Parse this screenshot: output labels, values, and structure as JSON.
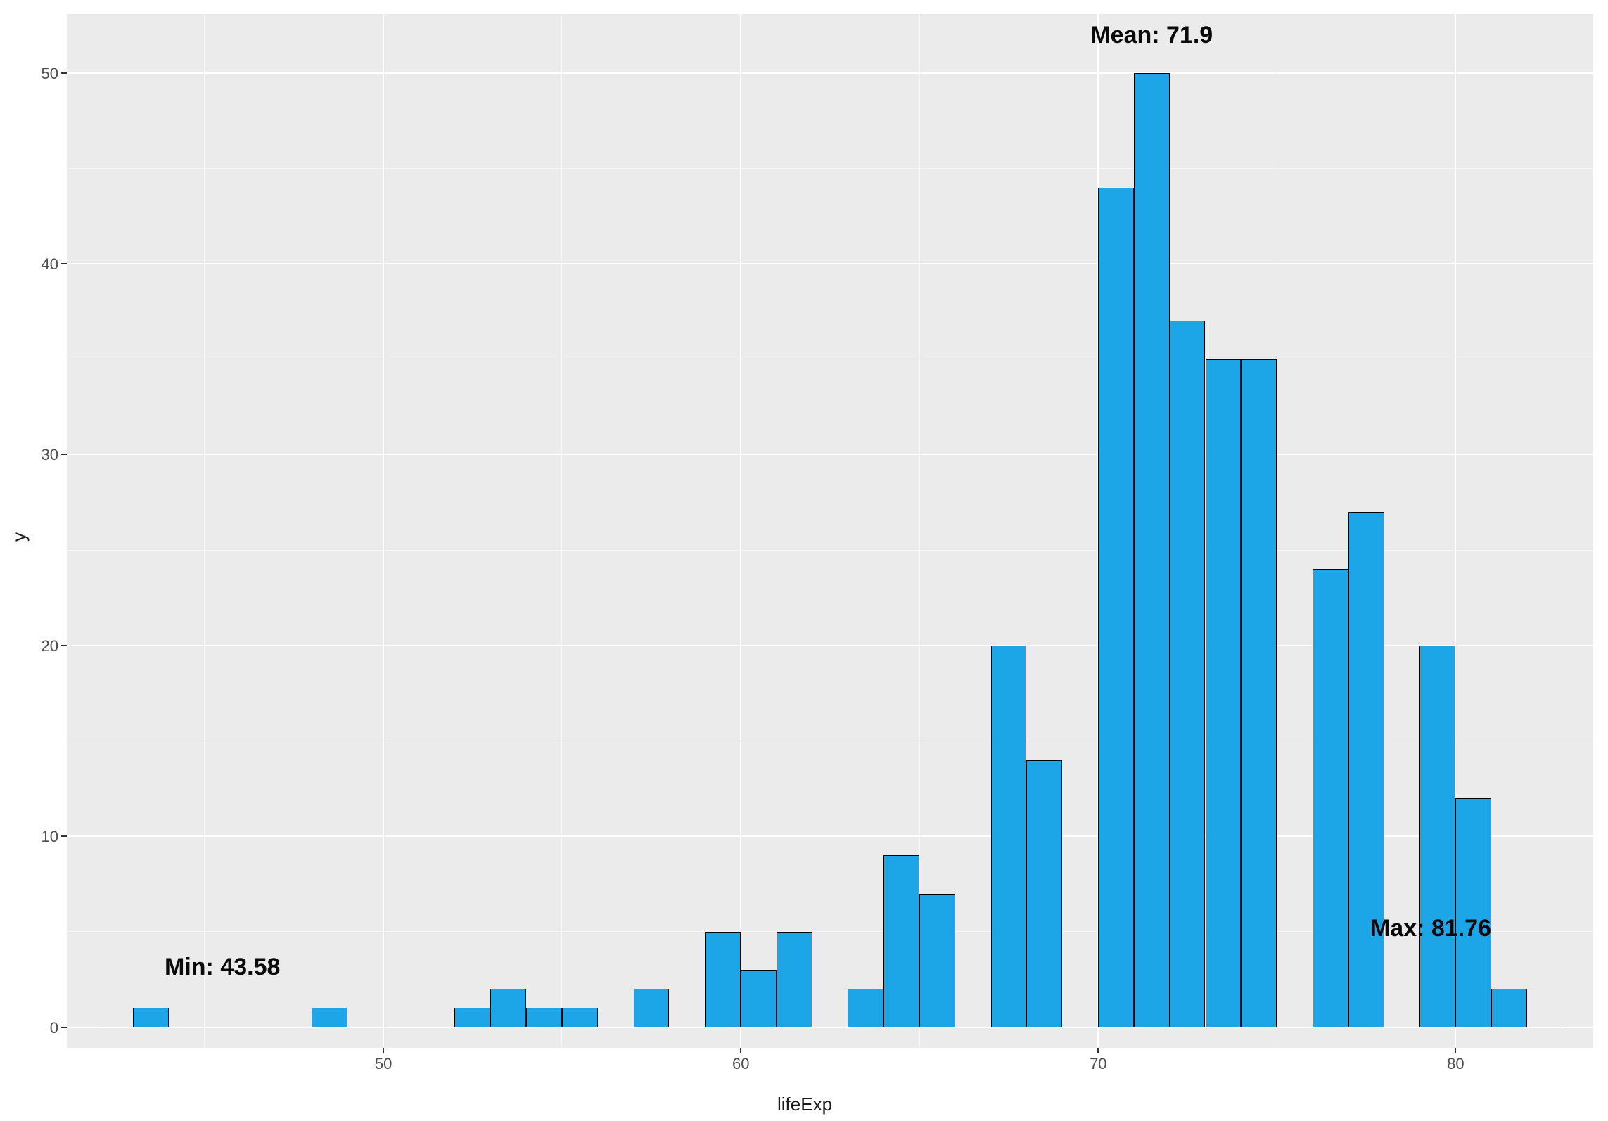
{
  "chart_data": {
    "type": "bar",
    "title": "",
    "xlabel": "lifeExp",
    "ylabel": "y",
    "xlim": [
      42,
      83
    ],
    "ylim": [
      0,
      52
    ],
    "x_ticks": [
      50,
      60,
      70,
      80
    ],
    "y_ticks": [
      0,
      10,
      20,
      30,
      40,
      50
    ],
    "bin_width": 1,
    "bins": [
      {
        "x": 43.5,
        "count": 1
      },
      {
        "x": 44.5,
        "count": 0
      },
      {
        "x": 45.5,
        "count": 0
      },
      {
        "x": 46.5,
        "count": 0
      },
      {
        "x": 47.5,
        "count": 0
      },
      {
        "x": 48.5,
        "count": 1
      },
      {
        "x": 49.5,
        "count": 0
      },
      {
        "x": 50.5,
        "count": 0
      },
      {
        "x": 51.5,
        "count": 0
      },
      {
        "x": 52.5,
        "count": 1
      },
      {
        "x": 53.5,
        "count": 2
      },
      {
        "x": 54.5,
        "count": 1
      },
      {
        "x": 55.5,
        "count": 1
      },
      {
        "x": 56.5,
        "count": 0
      },
      {
        "x": 57.5,
        "count": 2
      },
      {
        "x": 58.5,
        "count": 0
      },
      {
        "x": 59.5,
        "count": 5
      },
      {
        "x": 60.5,
        "count": 3
      },
      {
        "x": 61.5,
        "count": 5
      },
      {
        "x": 62.5,
        "count": 0
      },
      {
        "x": 63.5,
        "count": 2
      },
      {
        "x": 64.5,
        "count": 9
      },
      {
        "x": 65.5,
        "count": 7
      },
      {
        "x": 66.5,
        "count": 0
      },
      {
        "x": 67.5,
        "count": 20
      },
      {
        "x": 68.5,
        "count": 14
      },
      {
        "x": 69.5,
        "count": 0
      },
      {
        "x": 70.5,
        "count": 44
      },
      {
        "x": 71.5,
        "count": 50
      },
      {
        "x": 72.5,
        "count": 37
      },
      {
        "x": 73.5,
        "count": 35
      },
      {
        "x": 74.5,
        "count": 35
      },
      {
        "x": 75.5,
        "count": 0
      },
      {
        "x": 76.5,
        "count": 24
      },
      {
        "x": 77.5,
        "count": 27
      },
      {
        "x": 78.5,
        "count": 0
      },
      {
        "x": 79.5,
        "count": 20
      },
      {
        "x": 80.5,
        "count": 12
      },
      {
        "x": 81.5,
        "count": 2
      }
    ],
    "annotations": {
      "min": {
        "label": "Min: 43.58",
        "x": 45.5,
        "y": 3.2
      },
      "mean": {
        "label": "Mean: 71.9",
        "x": 71.5,
        "y": 52
      },
      "max": {
        "label": "Max: 81.76",
        "x": 81.0,
        "y": 5.2
      }
    },
    "colors": {
      "bar_fill": "#1ca6e8",
      "bar_stroke": "#000000",
      "panel_bg": "#ebebeb",
      "grid": "#ffffff"
    }
  }
}
